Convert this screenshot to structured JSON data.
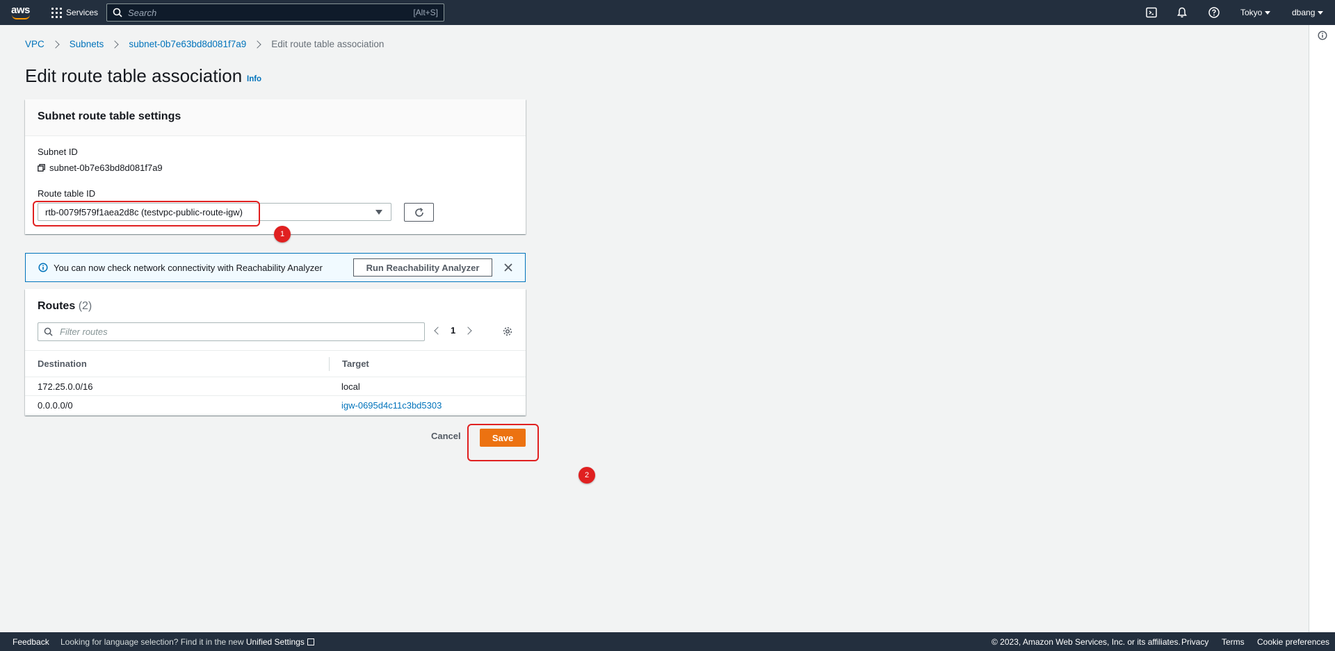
{
  "nav": {
    "logo": "aws",
    "services": "Services",
    "search_placeholder": "Search",
    "search_shortcut": "[Alt+S]",
    "region": "Tokyo",
    "user": "dbang",
    "icons": [
      "cloudshell-icon",
      "bell-icon",
      "help-icon"
    ]
  },
  "breadcrumb": {
    "items": [
      "VPC",
      "Subnets",
      "subnet-0b7e63bd8d081f7a9"
    ],
    "current": "Edit route table association"
  },
  "page": {
    "title": "Edit route table association",
    "info": "Info"
  },
  "settings": {
    "header": "Subnet route table settings",
    "subnet_id_label": "Subnet ID",
    "subnet_id_value": "subnet-0b7e63bd8d081f7a9",
    "route_table_label": "Route table ID",
    "route_table_value": "rtb-0079f579f1aea2d8c (testvpc-public-route-igw)"
  },
  "alert": {
    "text": "You can now check network connectivity with Reachability Analyzer",
    "button": "Run Reachability Analyzer"
  },
  "routes": {
    "title": "Routes",
    "count": "(2)",
    "filter_placeholder": "Filter routes",
    "page": "1",
    "columns": [
      "Destination",
      "Target"
    ],
    "rows": [
      {
        "destination": "172.25.0.0/16",
        "target": "local"
      },
      {
        "destination": "0.0.0.0/0",
        "target": "igw-0695d4c11c3bd5303"
      }
    ]
  },
  "actions": {
    "cancel": "Cancel",
    "save": "Save"
  },
  "annotations": [
    "1",
    "2"
  ],
  "footer": {
    "feedback": "Feedback",
    "language_text": "Looking for language selection? Find it in the new",
    "unified_settings": "Unified Settings",
    "copyright": "© 2023, Amazon Web Services, Inc. or its affiliates.",
    "privacy": "Privacy",
    "terms": "Terms",
    "cookie": "Cookie preferences"
  },
  "colors": {
    "nav_bg": "#232f3e",
    "link": "#0073bb",
    "primary": "#ec7211",
    "annotation": "#e02020"
  }
}
